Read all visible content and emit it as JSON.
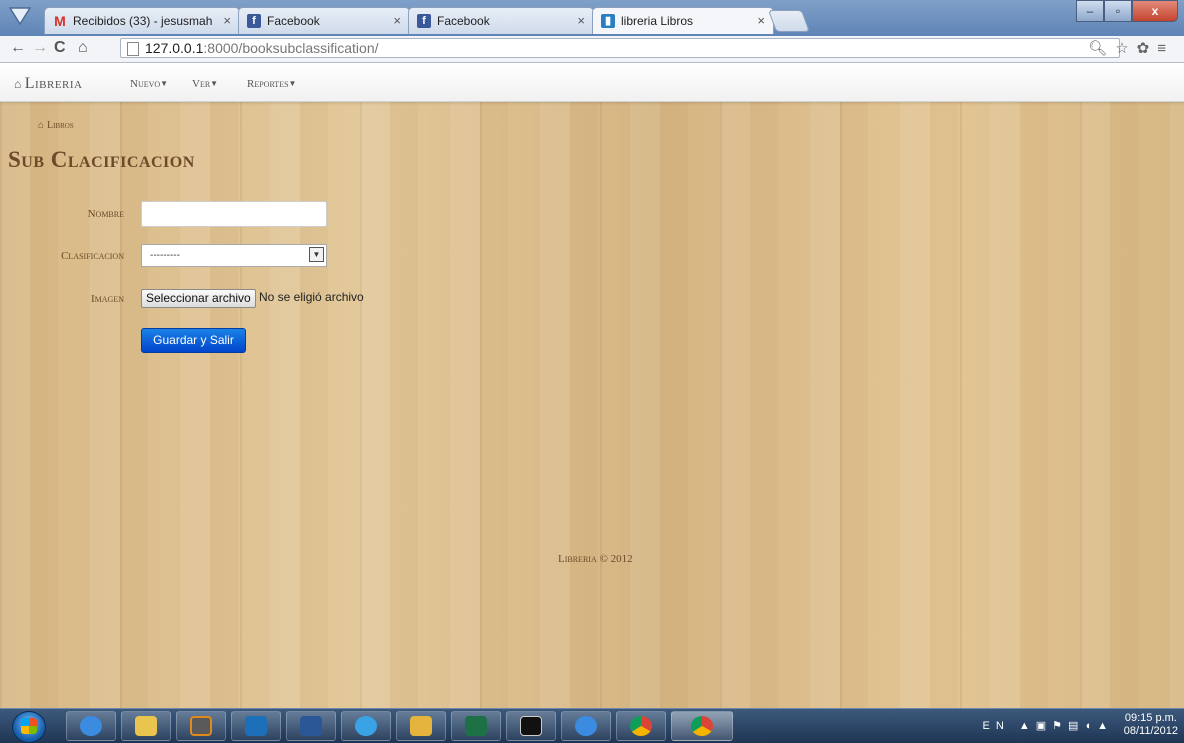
{
  "browser": {
    "tabs": [
      {
        "label": "Recibidos (33) - jesusmah",
        "favicon": "M",
        "favicon_color": "#d93025"
      },
      {
        "label": "Facebook",
        "favicon": "f",
        "favicon_color": "#3b5998"
      },
      {
        "label": "Facebook",
        "favicon": "f",
        "favicon_color": "#3b5998"
      },
      {
        "label": "libreria Libros",
        "favicon": "▮",
        "favicon_color": "#2a7fc1"
      }
    ],
    "tab_close": "×",
    "url_host": "127.0.0.1",
    "url_path": ":8000/booksubclassification/",
    "window_buttons": {
      "minimize": "–",
      "maximize": "▫",
      "close": "x"
    }
  },
  "navbar": {
    "brand": "Libreria",
    "menus": [
      {
        "label": "Nuevo"
      },
      {
        "label": "Ver"
      },
      {
        "label": "Reportes"
      }
    ]
  },
  "breadcrumb": {
    "label": "Libros"
  },
  "page_title": "Sub Clacificacion",
  "form": {
    "nombre_label": "Nombre",
    "nombre_value": "",
    "clasificacion_label": "Clasificacion",
    "clasificacion_value": "---------",
    "imagen_label": "Imagen",
    "file_button": "Seleccionar archivo",
    "file_status": "No se eligió archivo",
    "submit": "Guardar y Salir"
  },
  "footer": {
    "text": "Libreria © 2012"
  },
  "taskbar": {
    "apps": [
      "ie-icon",
      "explorer-icon",
      "sublime-icon",
      "media-icon",
      "word-icon",
      "ie-edge-icon",
      "folder-icon",
      "excel-icon",
      "cmd-icon",
      "ie-icon",
      "chrome-icon",
      "chrome-canary-icon"
    ],
    "language": "EN",
    "time": "09:15 p.m.",
    "date": "08/11/2012"
  },
  "colors": {
    "accent": "#0044cc",
    "brand_text": "#555555",
    "title_text": "#6d4a2a"
  }
}
